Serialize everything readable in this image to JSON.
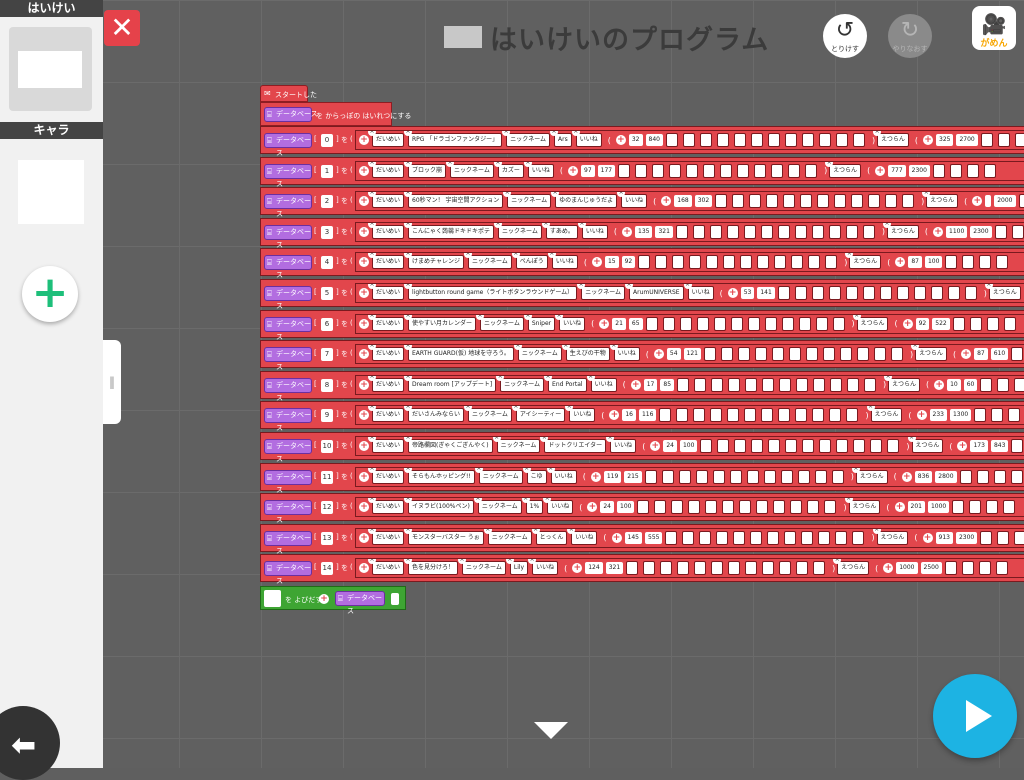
{
  "sidebar": {
    "background_header": "はいけい",
    "character_header": "キャラ",
    "add_label": "+"
  },
  "header": {
    "title": "はいけいのプログラム",
    "undo_label": "とりけす",
    "redo_label": "やりなおす",
    "screen_label": "がめん"
  },
  "program": {
    "start_label": "スタートした",
    "init_label": "を からっぽの はいれつにする",
    "db_label": "データベース",
    "set_label": "を",
    "return_label": "を よびだす",
    "field_name": "だいめい",
    "field_nick": "ニックネーム",
    "field_like": "いいね",
    "field_total": "えつらん",
    "rows": [
      {
        "idx": "0",
        "title": "RPG 「ドラゴンファンタジー」",
        "nick": "Ars",
        "a": "32",
        "b": "840",
        "c": "325",
        "d": "2700"
      },
      {
        "idx": "1",
        "title": "ブロック崩",
        "nick": "カズー",
        "a": "97",
        "b": "177",
        "c": "777",
        "d": "2300"
      },
      {
        "idx": "2",
        "title": "60秒マン！ 宇宙空間アクション",
        "nick": "ゆのまんじゅうだよ",
        "a": "168",
        "b": "302",
        "c": "",
        "d": "2000"
      },
      {
        "idx": "3",
        "title": "こんにゃく蒟蒻ドキドキポテ",
        "nick": "すあめ。",
        "a": "135",
        "b": "321",
        "c": "1100",
        "d": "2300"
      },
      {
        "idx": "4",
        "title": "けまめチャレンジ",
        "nick": "ぺんぽう",
        "a": "15",
        "b": "92",
        "c": "87",
        "d": "100"
      },
      {
        "idx": "5",
        "title": "lightbutton round game（ライトボタンラウンドゲーム）",
        "nick": "ArumUNIVERSE",
        "a": "53",
        "b": "141",
        "c": "",
        "d": ""
      },
      {
        "idx": "6",
        "title": "使やすい月カレンダー",
        "nick": "Sniper",
        "a": "21",
        "b": "65",
        "c": "92",
        "d": "522"
      },
      {
        "idx": "7",
        "title": "EARTH GUARD(仮) 地球を守ろう。",
        "nick": "生えびの干物",
        "a": "54",
        "b": "121",
        "c": "87",
        "d": "610"
      },
      {
        "idx": "8",
        "title": "Dream room [アップデート]",
        "nick": "End Portal",
        "a": "17",
        "b": "85",
        "c": "10",
        "d": "60"
      },
      {
        "idx": "9",
        "title": "だいさんみならい",
        "nick": "アイシーティー",
        "a": "16",
        "b": "116",
        "c": "233",
        "d": "1300"
      },
      {
        "idx": "10",
        "title": "帝路欄図(ぎゃくごぎんやく)",
        "nick": "ドットクリエイター",
        "a": "24",
        "b": "100",
        "c": "173",
        "d": "843"
      },
      {
        "idx": "11",
        "title": "そらもんホッピング!!",
        "nick": "こゆ",
        "a": "119",
        "b": "215",
        "c": "836",
        "d": "2800"
      },
      {
        "idx": "12",
        "title": "イヌラビ(100%ペン)",
        "nick": "1%",
        "a": "24",
        "b": "100",
        "c": "201",
        "d": "1000"
      },
      {
        "idx": "13",
        "title": "モンスターバスター うぉ",
        "nick": "とっくん",
        "a": "145",
        "b": "555",
        "c": "913",
        "d": "2300"
      },
      {
        "idx": "14",
        "title": "色を見分けろ！",
        "nick": "Lily",
        "a": "124",
        "b": "321",
        "c": "1000",
        "d": "2500"
      }
    ]
  },
  "colors": {
    "block_red": "#e2464c",
    "db_purple": "#b26de0",
    "return_green": "#3ea533",
    "play_blue": "#1db3e3",
    "close_red": "#e5424a"
  }
}
